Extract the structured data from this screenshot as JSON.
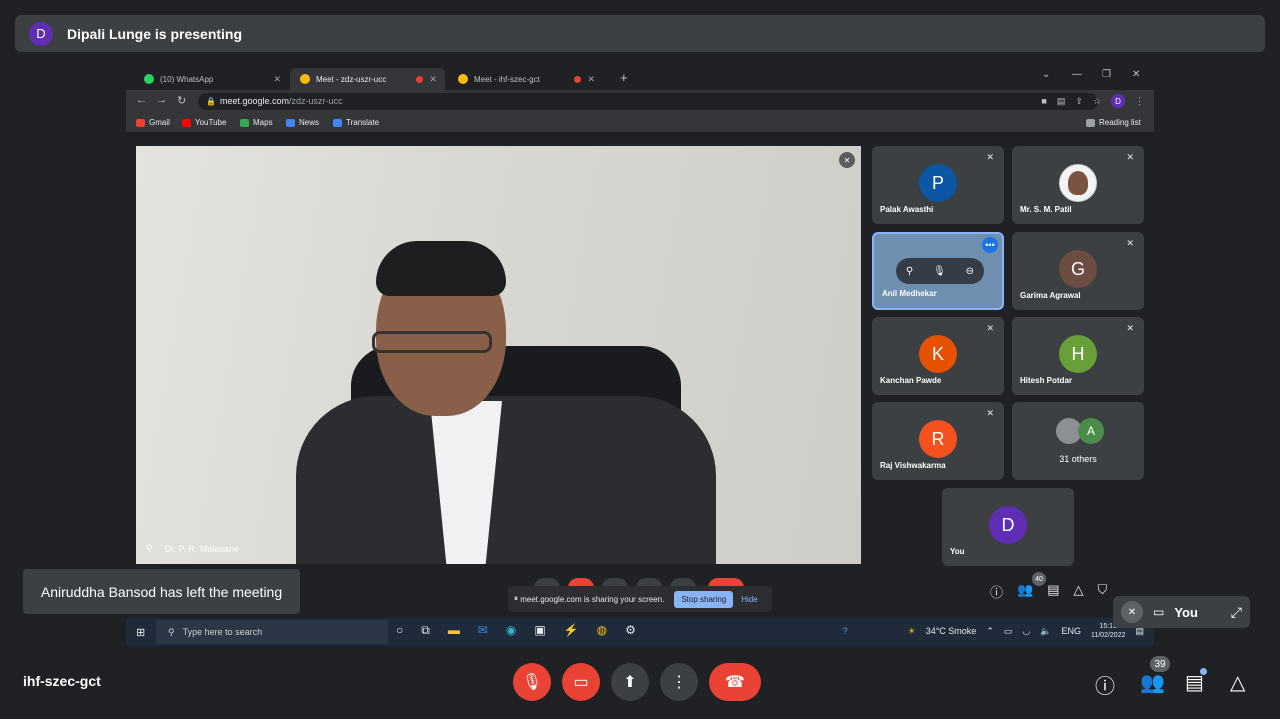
{
  "presenting": {
    "avatar": "D",
    "text": "Dipali Lunge is presenting"
  },
  "browser": {
    "tabs": [
      {
        "label": "(10) WhatsApp",
        "color": "#25d366"
      },
      {
        "label": "Meet - zdz-uszr-ucc",
        "color": "#fbbc04"
      },
      {
        "label": "Meet - ihf-szec-gct",
        "color": "#fbbc04"
      }
    ],
    "url_host": "meet.google.com",
    "url_path": "/zdz-uszr-ucc",
    "profile": "D",
    "bookmarks": [
      {
        "label": "Gmail",
        "color": "#ea4335"
      },
      {
        "label": "YouTube",
        "color": "#ff0000"
      },
      {
        "label": "Maps",
        "color": "#34a853"
      },
      {
        "label": "News",
        "color": "#4285f4"
      },
      {
        "label": "Translate",
        "color": "#4285f4"
      }
    ],
    "reading_list": "Reading list"
  },
  "main_video": {
    "name": "Dr. P. R. Malasane"
  },
  "tiles": [
    {
      "name": "Palak Awasthi",
      "initial": "P",
      "color": "#0b57a6"
    },
    {
      "name": "Mr. S. M. Patil",
      "initial": "",
      "color": "#f1f3f4"
    },
    {
      "name": "Anil Medhekar",
      "initial": "",
      "color": "#6f8fb0"
    },
    {
      "name": "Garima Agrawal",
      "initial": "G",
      "color": "#6d4c41"
    },
    {
      "name": "Kanchan Pawde",
      "initial": "K",
      "color": "#e65100"
    },
    {
      "name": "Hitesh Potdar",
      "initial": "H",
      "color": "#689f38"
    },
    {
      "name": "Raj Vishwakarma",
      "initial": "R",
      "color": "#f4511e"
    }
  ],
  "others": {
    "text": "31 others",
    "initial": "A"
  },
  "you_tile": {
    "name": "You",
    "initial": "D",
    "color": "#5f2eb4"
  },
  "inner_count": "40",
  "share_banner": {
    "text": "meet.google.com is sharing your screen.",
    "stop": "Stop sharing",
    "hide": "Hide"
  },
  "taskbar": {
    "search": "Type here to search",
    "weather": "34°C  Smoke",
    "lang": "ENG",
    "time": "15:15",
    "date": "11/02/2022"
  },
  "toast": "Aniruddha Bansod has left the meeting",
  "pip": {
    "label": "You"
  },
  "meeting_code": "ihf-szec-gct",
  "participant_count": "39"
}
